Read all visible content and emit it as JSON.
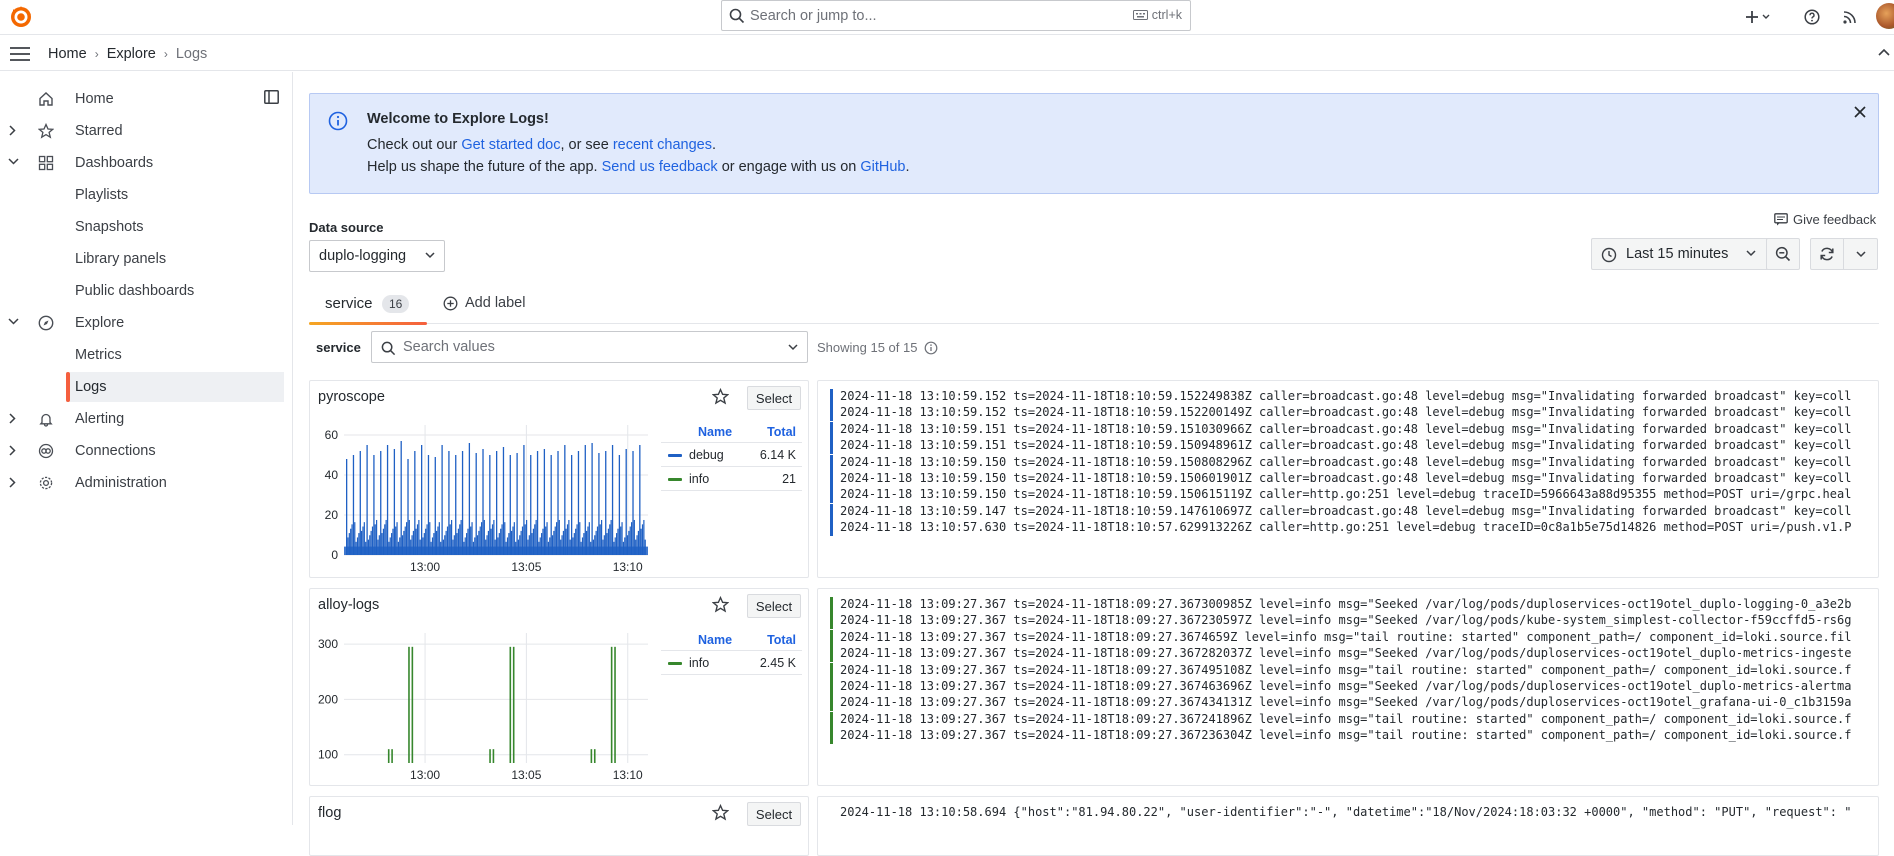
{
  "topbar": {
    "search_placeholder": "Search or jump to...",
    "search_shortcut": "ctrl+k",
    "icons": [
      "grafana-logo-icon",
      "plus-icon",
      "help-icon",
      "news-icon",
      "avatar"
    ]
  },
  "breadcrumb": {
    "home": "Home",
    "explore": "Explore",
    "current": "Logs"
  },
  "sidebar": {
    "items": [
      {
        "label": "Home",
        "icon": "home-icon",
        "expandable": false
      },
      {
        "label": "Starred",
        "icon": "star-icon",
        "expandable": true
      },
      {
        "label": "Dashboards",
        "icon": "apps-icon",
        "expandable": true,
        "expanded": true
      },
      {
        "label": "Playlists",
        "sub": true
      },
      {
        "label": "Snapshots",
        "sub": true
      },
      {
        "label": "Library panels",
        "sub": true
      },
      {
        "label": "Public dashboards",
        "sub": true
      },
      {
        "label": "Explore",
        "icon": "compass-icon",
        "expandable": true,
        "expanded": true
      },
      {
        "label": "Metrics",
        "sub": true
      },
      {
        "label": "Logs",
        "sub": true,
        "active": true
      },
      {
        "label": "Alerting",
        "icon": "bell-icon",
        "expandable": true
      },
      {
        "label": "Connections",
        "icon": "link-icon",
        "expandable": true
      },
      {
        "label": "Administration",
        "icon": "cog-icon",
        "expandable": true
      }
    ]
  },
  "banner": {
    "title": "Welcome to Explore Logs!",
    "line1_a": "Check out our ",
    "line1_link1": "Get started doc",
    "line1_b": ", or see ",
    "line1_link2": "recent changes",
    "line1_c": ".",
    "line2_a": "Help us shape the future of the app. ",
    "line2_link1": "Send us feedback",
    "line2_b": " or engage with us on ",
    "line2_link2": "GitHub",
    "line2_c": "."
  },
  "feedback": "Give feedback",
  "datasource": {
    "label": "Data source",
    "value": "duplo-logging"
  },
  "time": {
    "range": "Last 15 minutes"
  },
  "tabs": {
    "service_label": "service",
    "service_count": "16",
    "add_label": "Add label"
  },
  "filter": {
    "label": "service",
    "placeholder": "Search values",
    "showing": "Showing 15 of 15"
  },
  "colors": {
    "debug": "#1f60c4",
    "info": "#37872d",
    "accent": "#f55f3e",
    "link": "#1f62e0"
  },
  "panels": [
    {
      "name": "pyroscope",
      "select_label": "Select",
      "legend_name": "Name",
      "legend_total": "Total",
      "legend": [
        {
          "name": "debug",
          "total": "6.14 K",
          "color": "#1f60c4"
        },
        {
          "name": "info",
          "total": "21",
          "color": "#37872d"
        }
      ],
      "log_color": "#1f60c4",
      "logs": [
        "2024-11-18 13:10:59.152 ts=2024-11-18T18:10:59.152249838Z caller=broadcast.go:48 level=debug msg=\"Invalidating forwarded broadcast\" key=coll",
        "2024-11-18 13:10:59.152 ts=2024-11-18T18:10:59.152200149Z caller=broadcast.go:48 level=debug msg=\"Invalidating forwarded broadcast\" key=coll",
        "2024-11-18 13:10:59.151 ts=2024-11-18T18:10:59.151030966Z caller=broadcast.go:48 level=debug msg=\"Invalidating forwarded broadcast\" key=coll",
        "2024-11-18 13:10:59.151 ts=2024-11-18T18:10:59.150948961Z caller=broadcast.go:48 level=debug msg=\"Invalidating forwarded broadcast\" key=coll",
        "2024-11-18 13:10:59.150 ts=2024-11-18T18:10:59.150808296Z caller=broadcast.go:48 level=debug msg=\"Invalidating forwarded broadcast\" key=coll",
        "2024-11-18 13:10:59.150 ts=2024-11-18T18:10:59.150601901Z caller=broadcast.go:48 level=debug msg=\"Invalidating forwarded broadcast\" key=coll",
        "2024-11-18 13:10:59.150 ts=2024-11-18T18:10:59.150615119Z caller=http.go:251 level=debug traceID=5966643a88d95355 method=POST uri=/grpc.heal",
        "2024-11-18 13:10:59.147 ts=2024-11-18T18:10:59.147610697Z caller=broadcast.go:48 level=debug msg=\"Invalidating forwarded broadcast\" key=coll",
        "2024-11-18 13:10:57.630 ts=2024-11-18T18:10:57.629913226Z caller=http.go:251 level=debug traceID=0c8a1b5e75d14826 method=POST uri=/push.v1.P"
      ]
    },
    {
      "name": "alloy-logs",
      "select_label": "Select",
      "legend_name": "Name",
      "legend_total": "Total",
      "legend": [
        {
          "name": "info",
          "total": "2.45 K",
          "color": "#37872d"
        }
      ],
      "log_color": "#37872d",
      "logs": [
        "2024-11-18 13:09:27.367 ts=2024-11-18T18:09:27.367300985Z level=info msg=\"Seeked /var/log/pods/duploservices-oct19otel_duplo-logging-0_a3e2b",
        "2024-11-18 13:09:27.367 ts=2024-11-18T18:09:27.367230597Z level=info msg=\"Seeked /var/log/pods/kube-system_simplest-collector-f59ccffd5-rs6g",
        "2024-11-18 13:09:27.367 ts=2024-11-18T18:09:27.3674659Z level=info msg=\"tail routine: started\" component_path=/ component_id=loki.source.fil",
        "2024-11-18 13:09:27.367 ts=2024-11-18T18:09:27.367282037Z level=info msg=\"Seeked /var/log/pods/duploservices-oct19otel_duplo-metrics-ingeste",
        "2024-11-18 13:09:27.367 ts=2024-11-18T18:09:27.367495108Z level=info msg=\"tail routine: started\" component_path=/ component_id=loki.source.f",
        "2024-11-18 13:09:27.367 ts=2024-11-18T18:09:27.367463696Z level=info msg=\"Seeked /var/log/pods/duploservices-oct19otel_duplo-metrics-alertma",
        "2024-11-18 13:09:27.367 ts=2024-11-18T18:09:27.367434131Z level=info msg=\"Seeked /var/log/pods/duploservices-oct19otel_grafana-ui-0_c1b3159a",
        "2024-11-18 13:09:27.367 ts=2024-11-18T18:09:27.367241896Z level=info msg=\"tail routine: started\" component_path=/ component_id=loki.source.f",
        "2024-11-18 13:09:27.367 ts=2024-11-18T18:09:27.367236304Z level=info msg=\"tail routine: started\" component_path=/ component_id=loki.source.f"
      ]
    },
    {
      "name": "flog",
      "select_label": "Select",
      "logs": [
        "2024-11-18 13:10:58.694 {\"host\":\"81.94.80.22\", \"user-identifier\":\"-\", \"datetime\":\"18/Nov/2024:18:03:32 +0000\", \"method\": \"PUT\", \"request\": \""
      ]
    }
  ],
  "chart_data": [
    {
      "type": "bar",
      "title": "pyroscope",
      "x_ticks": [
        "13:00",
        "13:05",
        "13:10"
      ],
      "y_ticks": [
        0,
        20,
        40,
        60
      ],
      "ylim": [
        0,
        65
      ],
      "series": [
        {
          "name": "debug",
          "color": "#1f60c4",
          "pattern": "dense-periodic",
          "base_value": 12,
          "peak_values": [
            48,
            50,
            52,
            55,
            50,
            52,
            55,
            53,
            57,
            48,
            52,
            55,
            50,
            49,
            55,
            52,
            50,
            52,
            56,
            51,
            53,
            50,
            52,
            54,
            50,
            51,
            55,
            50,
            52,
            53,
            50,
            52,
            55,
            50,
            52,
            55,
            56,
            51,
            52,
            55,
            50,
            53,
            52,
            55
          ]
        },
        {
          "name": "info",
          "color": "#37872d",
          "values_note": "sparse"
        }
      ]
    },
    {
      "type": "bar",
      "title": "alloy-logs",
      "x_ticks": [
        "13:00",
        "13:05",
        "13:10"
      ],
      "y_ticks": [
        100,
        200,
        300
      ],
      "ylim": [
        85,
        320
      ],
      "series": [
        {
          "name": "info",
          "color": "#37872d",
          "bars": [
            {
              "t": "12:58:10",
              "v": 110
            },
            {
              "t": "12:58:20",
              "v": 110
            },
            {
              "t": "12:59:10",
              "v": 295
            },
            {
              "t": "12:59:20",
              "v": 295
            },
            {
              "t": "13:03:10",
              "v": 110
            },
            {
              "t": "13:03:20",
              "v": 110
            },
            {
              "t": "13:04:10",
              "v": 295
            },
            {
              "t": "13:04:20",
              "v": 295
            },
            {
              "t": "13:08:10",
              "v": 110
            },
            {
              "t": "13:08:20",
              "v": 110
            },
            {
              "t": "13:09:10",
              "v": 295
            },
            {
              "t": "13:09:20",
              "v": 295
            }
          ]
        }
      ]
    }
  ]
}
